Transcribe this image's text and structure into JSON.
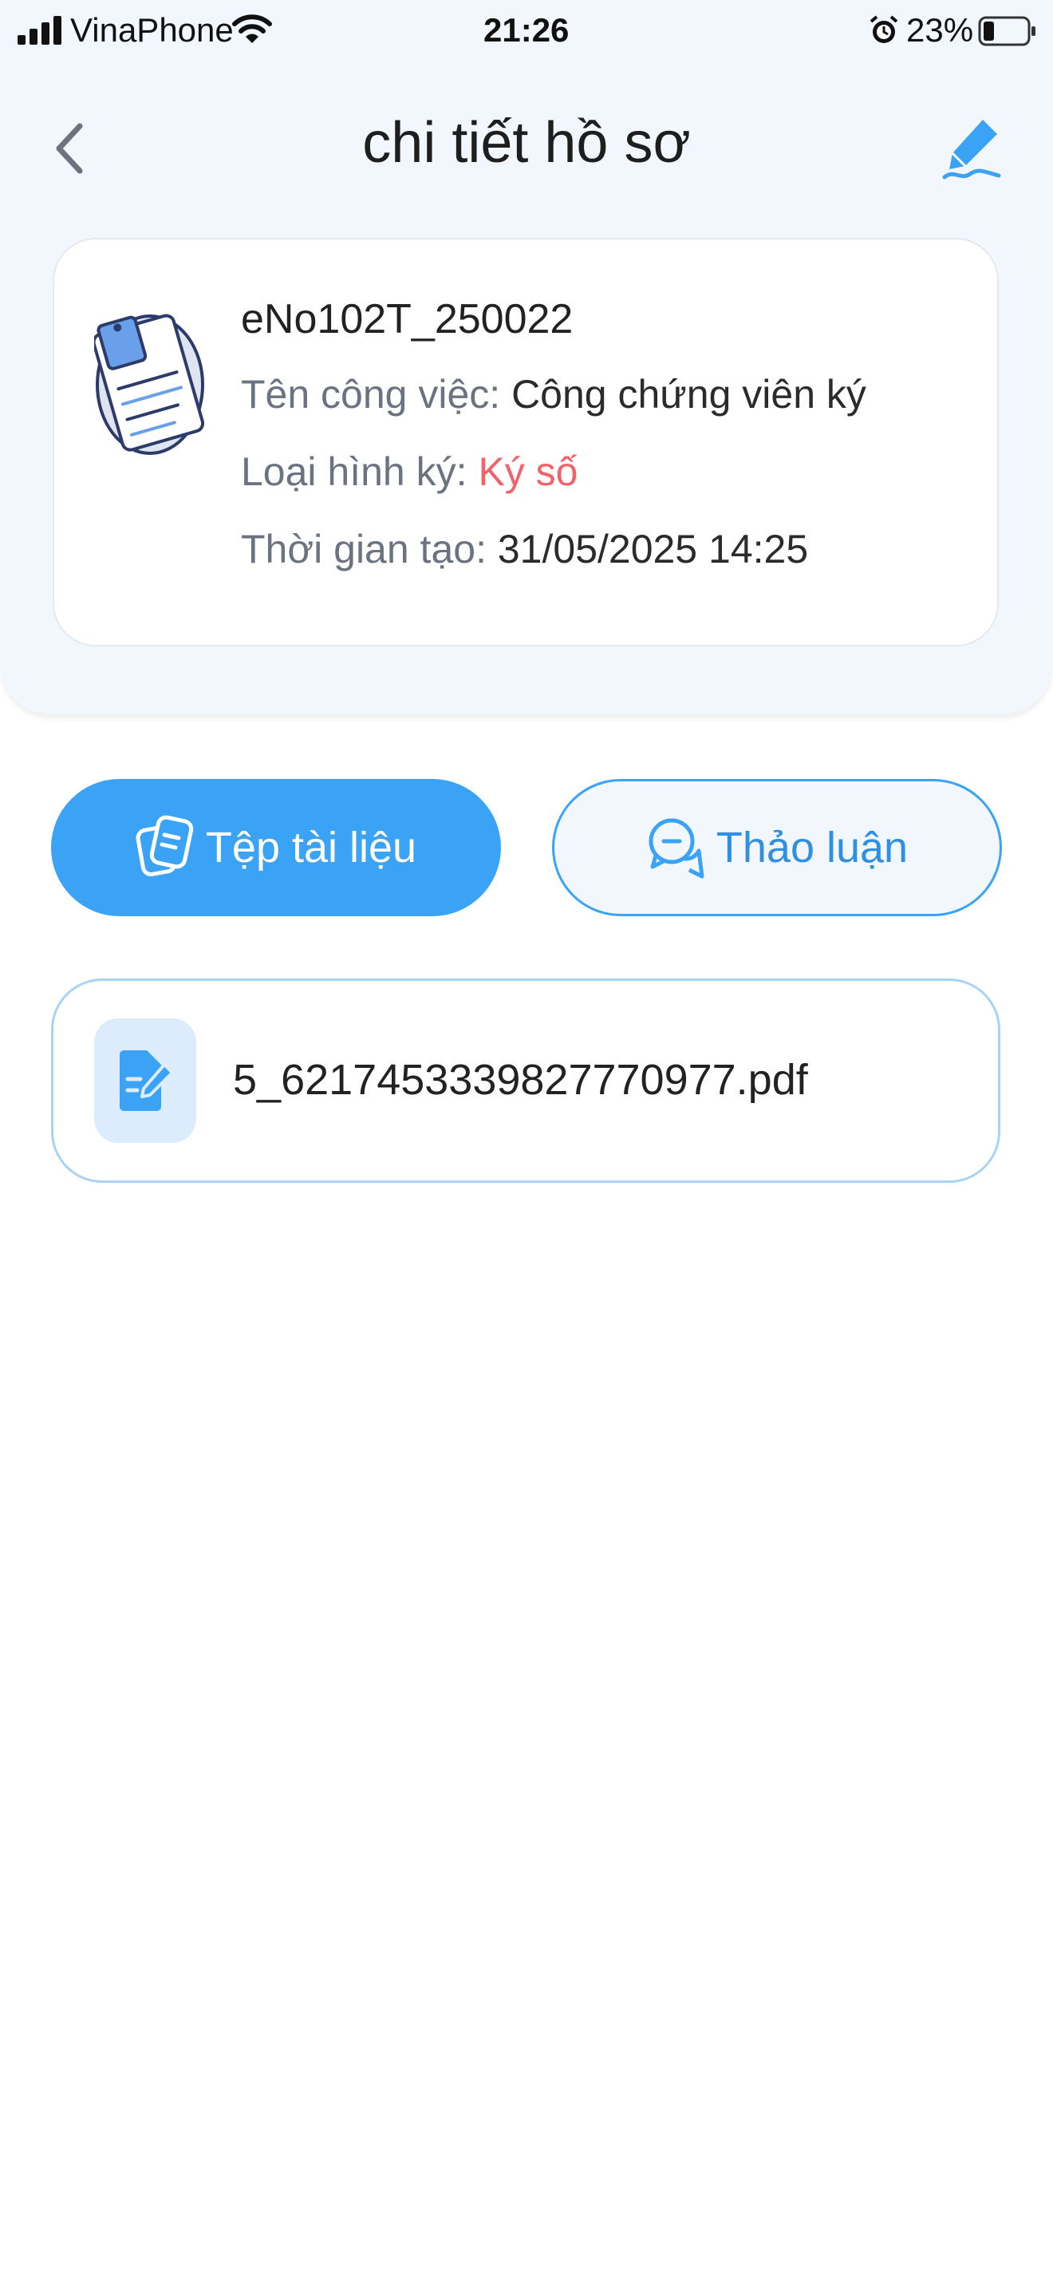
{
  "status_bar": {
    "carrier": "VinaPhone",
    "time": "21:26",
    "battery": "23%"
  },
  "header": {
    "title": "chi tiết hồ sơ"
  },
  "record": {
    "code": "eNo102T_250022",
    "fields": [
      {
        "label": "Tên công việc:",
        "value": "Công chứng viên ký"
      },
      {
        "label": "Loại hình ký:",
        "value": "Ký số"
      },
      {
        "label": "Thời gian tạo:",
        "value": "31/05/2025 14:25"
      }
    ]
  },
  "tabs": [
    {
      "label": "Tệp tài liệu",
      "active": true
    },
    {
      "label": "Thảo luận",
      "active": false
    }
  ],
  "files": [
    {
      "name": "5_6217453339827770977.pdf"
    }
  ],
  "colors": {
    "accent": "#3ba3f5",
    "header_bg": "#f2f7fd",
    "sign_type": "#f0636a"
  },
  "icons": {
    "back": "chevron-left-icon",
    "edit": "pen-sign-icon",
    "record": "document-icon",
    "docs_tab": "documents-icon",
    "talk_tab": "chat-bubbles-icon",
    "file": "file-sign-icon"
  }
}
